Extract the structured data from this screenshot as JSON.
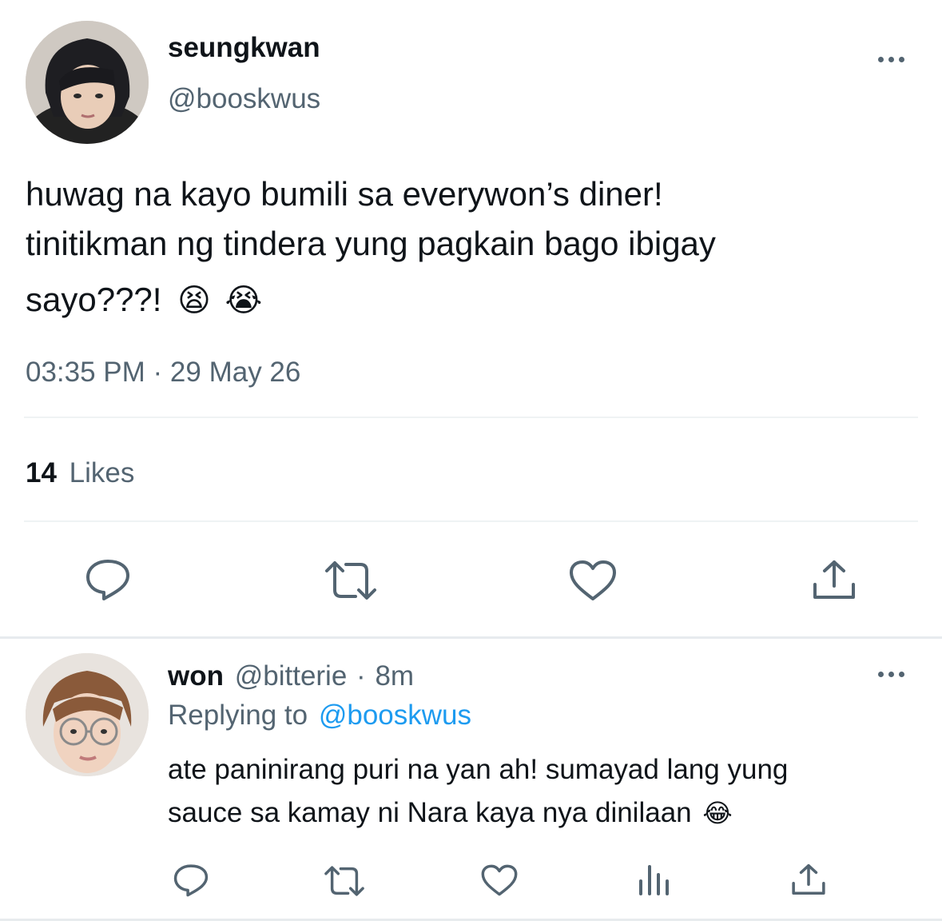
{
  "main_tweet": {
    "display_name": "seungkwan",
    "handle": "@booskwus",
    "text_line1": "huwag na kayo bumili sa everywon’s diner!",
    "text_line2": "tinitikman ng tindera yung pagkain bago ibigay",
    "text_line3": "sayo???!",
    "emoji_1": "😫",
    "emoji_2": "😭",
    "timestamp": "03:35 PM · 29 May 26",
    "likes_count": "14",
    "likes_label": "Likes",
    "icons": [
      "reply-icon",
      "retweet-icon",
      "like-icon",
      "share-icon"
    ]
  },
  "reply": {
    "display_name": "won",
    "handle": "@bitterie",
    "separator": "·",
    "time": "8m",
    "replying_to_label": "Replying to",
    "replying_to_handle": "@booskwus",
    "text_line1": "ate paninirang puri na yan ah! sumayad lang yung",
    "text_line2": "sauce sa kamay ni Nara kaya nya dinilaan",
    "emoji": "😂",
    "icons": [
      "reply-icon",
      "retweet-icon",
      "like-icon",
      "analytics-icon",
      "share-icon"
    ]
  },
  "colors": {
    "text": "#0f1419",
    "muted": "#536471",
    "link": "#1d9bf0",
    "divider": "#eff3f4"
  }
}
